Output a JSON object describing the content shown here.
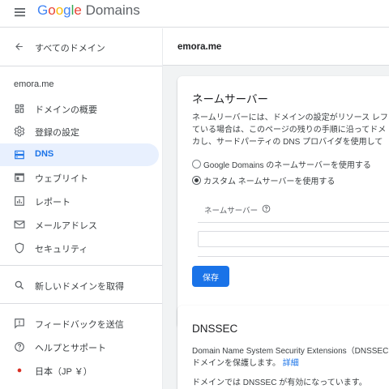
{
  "app": {
    "logo_google": "Google",
    "logo_domains": "Domains",
    "google_colors": [
      "#4285f4",
      "#ea4335",
      "#fbbc05",
      "#4285f4",
      "#34a853",
      "#ea4335"
    ]
  },
  "sidebar": {
    "back_label": "すべてのドメイン",
    "domain": "emora.me",
    "items": [
      {
        "label": "ドメインの概要",
        "icon": "dashboard-icon"
      },
      {
        "label": "登録の設定",
        "icon": "gear-icon"
      },
      {
        "label": "DNS",
        "icon": "dns-icon",
        "active": true
      },
      {
        "label": "ウェブリイト",
        "icon": "web-icon"
      },
      {
        "label": "レポート",
        "icon": "report-icon"
      },
      {
        "label": "メールアドレス",
        "icon": "mail-icon"
      },
      {
        "label": "セキュリティ",
        "icon": "shield-icon"
      }
    ],
    "search_label": "新しいドメインを取得",
    "footer": [
      {
        "label": "フィードバックを送信",
        "icon": "feedback-icon"
      },
      {
        "label": "ヘルプとサポート",
        "icon": "help-icon"
      },
      {
        "label": "日本（JP ￥）",
        "icon": "japan-flag-icon"
      }
    ]
  },
  "main": {
    "header_title": "emora.me",
    "nameserver_card": {
      "title": "ネームサーバー",
      "desc_lines": [
        "ネームリーバーには、ドメインの設定がリソース レフ",
        "ている場合は、このページの残りの手順に沿ってドメ",
        "カし、サードパーティの DNS プロバイダを使用して"
      ],
      "radio_default": "Google Domains のネームサーバーを使用する",
      "radio_custom": "カスタム ネームサーバーを使用する",
      "selected": "custom",
      "ns_label": "ネームサーバー",
      "ns_input_value": "",
      "save_label": "保存"
    },
    "dnssec_card": {
      "title": "DNSSEC",
      "desc_line1": "Domain Name System Security Extensions（DNSSEC",
      "desc_line2": "ドメインを保護します。",
      "link": "詳細",
      "status": "ドメインでは DNSSEC が有効になっています。"
    }
  }
}
